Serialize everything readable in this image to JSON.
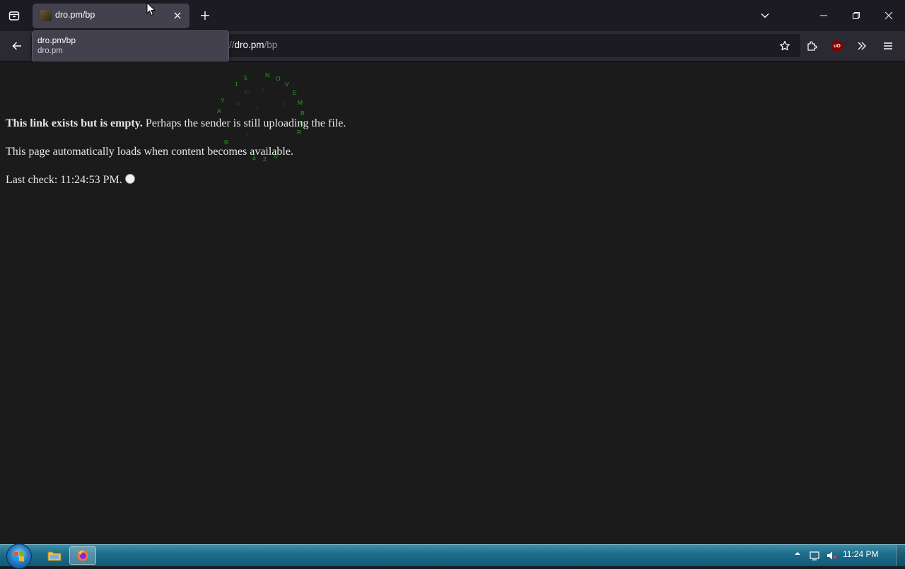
{
  "tab": {
    "title": "dro.pm/bp"
  },
  "tooltip": {
    "title": "dro.pm/bp",
    "host": "dro.pm"
  },
  "urlbar": {
    "visible_prefix": "//",
    "host": "dro.pm",
    "path": "/bp"
  },
  "content": {
    "bold_text": "This link exists but is empty.",
    "rest_text": " Perhaps the sender is still uploading the file.",
    "auto_text": "This page automatically loads when content becomes available.",
    "last_check_label": "Last check: ",
    "last_check_time": "11:24:53 PM.",
    "clock_letters_green": [
      "5",
      "N",
      "O",
      "V",
      "E",
      "M",
      "B",
      "E",
      "R",
      "1",
      "Y",
      "A",
      "R",
      "4",
      "2",
      "0"
    ],
    "clock_letters_dim": [
      "40",
      "7",
      "12",
      "1",
      "1",
      "8",
      "5"
    ]
  },
  "taskbar": {
    "clock": "11:24 PM"
  },
  "colors": {
    "page_bg": "#1b1b1b",
    "text": "#e8e8e8",
    "clock_green": "#1fa31f",
    "toolbar": "#2b2a33"
  }
}
